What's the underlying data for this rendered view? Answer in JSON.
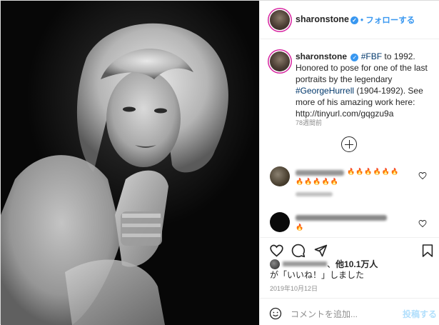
{
  "post": {
    "username": "sharonstone",
    "follow_label": "フォローする",
    "caption": {
      "username": "sharonstone",
      "parts": [
        {
          "text": "#FBF",
          "link": true
        },
        {
          "text": " to 1992. Honored to pose for one of the last portraits by the legendary ",
          "link": false
        },
        {
          "text": "#GeorgeHurrell",
          "link": true
        },
        {
          "text": " (1904-1992). See more of his amazing work here: http://tinyurl.com/gqgzu9a",
          "link": false
        }
      ]
    },
    "time_ago": "78週間前",
    "comments": [
      {
        "emoji_text": "🔥🔥🔥🔥🔥🔥"
      },
      {
        "emoji_text": "🔥🔥🔥🔥🔥"
      },
      {
        "emoji_text": "🔥"
      }
    ],
    "likes": {
      "prefix": "、",
      "count_text": "他10.1万人",
      "suffix": "が「いいね！」しました"
    },
    "date": "2019年10月12日",
    "comment_placeholder": "コメントを追加...",
    "post_button": "投稿する"
  },
  "colors": {
    "accent": "#3897f0",
    "link": "#00376b",
    "muted": "#8e8e8e",
    "post_disabled": "#b2dffc"
  },
  "icons": [
    "verified-badge-icon",
    "plus-circle-icon",
    "heart-icon",
    "comment-icon",
    "share-icon",
    "bookmark-icon",
    "emoji-icon"
  ]
}
